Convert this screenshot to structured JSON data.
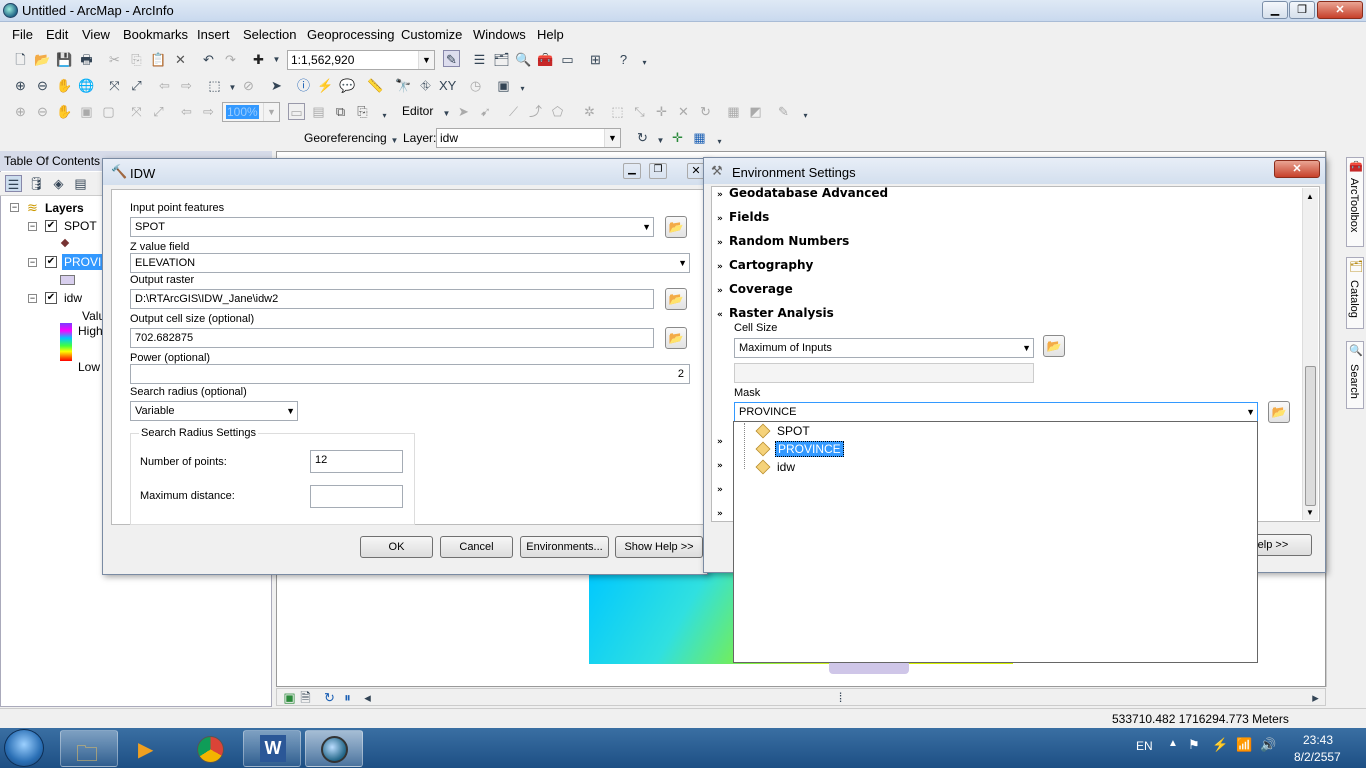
{
  "window": {
    "title": "Untitled - ArcMap - ArcInfo",
    "minimize": "▁",
    "maximize": "❐",
    "close": "✕"
  },
  "menubar": {
    "items": [
      "File",
      "Edit",
      "View",
      "Bookmarks",
      "Insert",
      "Selection",
      "Geoprocessing",
      "Customize",
      "Windows",
      "Help"
    ]
  },
  "toolbar": {
    "scale": "1:1,562,920",
    "zoom_percent": "100%",
    "editor_label": "Editor",
    "georeferencing_label": "Georeferencing",
    "layer_label": "Layer:",
    "layer_value": "idw"
  },
  "toc": {
    "title": "Table Of Contents",
    "root": "Layers",
    "layers": [
      {
        "name": "SPOT",
        "checked": true
      },
      {
        "name": "PROVINCE",
        "checked": true
      },
      {
        "name": "idw",
        "checked": true
      }
    ],
    "legend_value_label": "Value",
    "legend_high": "High",
    "legend_low": "Low"
  },
  "idw_dialog": {
    "title": "IDW",
    "input_label": "Input point features",
    "input_value": "SPOT",
    "z_label": "Z value field",
    "z_value": "ELEVATION",
    "output_label": "Output raster",
    "output_value": "D:\\RTArcGIS\\IDW_Jane\\idw2",
    "cellsize_label": "Output cell size (optional)",
    "cellsize_value": "702.682875",
    "power_label": "Power (optional)",
    "power_value": "2",
    "radius_label": "Search radius (optional)",
    "radius_value": "Variable",
    "group_label": "Search Radius Settings",
    "points_label": "Number of points:",
    "points_value": "12",
    "maxdist_label": "Maximum distance:",
    "maxdist_value": "",
    "ok": "OK",
    "cancel": "Cancel",
    "environments": "Environments...",
    "show_help": "Show Help >>"
  },
  "env_dialog": {
    "title": "Environment Settings",
    "sections": [
      "Geodatabase Advanced",
      "Fields",
      "Random Numbers",
      "Cartography",
      "Coverage",
      "Raster Analysis"
    ],
    "cellsize_label": "Cell Size",
    "cellsize_value": "Maximum of Inputs",
    "mask_label": "Mask",
    "mask_value": "PROVINCE",
    "dropdown_items": [
      "SPOT",
      "PROVINCE",
      "idw"
    ],
    "help_button": "Help >>"
  },
  "side_tabs": [
    "ArcToolbox",
    "Catalog",
    "Search"
  ],
  "statusbar": {
    "coords": "533710.482  1716294.773 Meters"
  },
  "taskbar": {
    "lang": "EN",
    "time": "23:43",
    "date": "8/2/2557"
  },
  "colors": {
    "selection": "#3399ff",
    "titlebar": "#d3dfee",
    "taskbar": "#1d4f84"
  }
}
